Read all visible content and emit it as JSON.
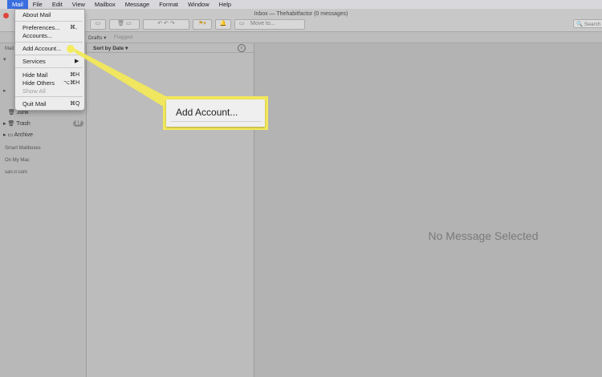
{
  "menubar": {
    "items": [
      "Mail",
      "File",
      "Edit",
      "View",
      "Mailbox",
      "Message",
      "Format",
      "Window",
      "Help"
    ]
  },
  "window": {
    "title": "Inbox — Thehabitfactor (0 messages)",
    "move_to": "Move to...",
    "search_placeholder": "Search"
  },
  "favorites": {
    "drafts": "Drafts",
    "flagged": "Flagged"
  },
  "sidebar": {
    "mailboxes_header": "Mail",
    "junk": "Junk",
    "trash": "Trash",
    "trash_badge": "17",
    "archive": "Archive",
    "smart_mailboxes": "Smart Mailboxes",
    "on_my_mac": "On My Mac",
    "account": "san.rr.com"
  },
  "list": {
    "sort_label": "Sort by Date"
  },
  "detail": {
    "empty_text": "No Message Selected"
  },
  "mail_menu": {
    "about": "About Mail",
    "preferences": "Preferences...",
    "preferences_shortcut": "⌘,",
    "accounts": "Accounts...",
    "add_account": "Add Account...",
    "services": "Services",
    "hide_mail": "Hide Mail",
    "hide_mail_shortcut": "⌘H",
    "hide_others": "Hide Others",
    "hide_others_shortcut": "⌥⌘H",
    "show_all": "Show All",
    "quit": "Quit Mail",
    "quit_shortcut": "⌘Q"
  },
  "callout": {
    "label": "Add Account..."
  },
  "colors": {
    "highlight": "#f2e85a",
    "menu_active": "#3b6ee0"
  }
}
